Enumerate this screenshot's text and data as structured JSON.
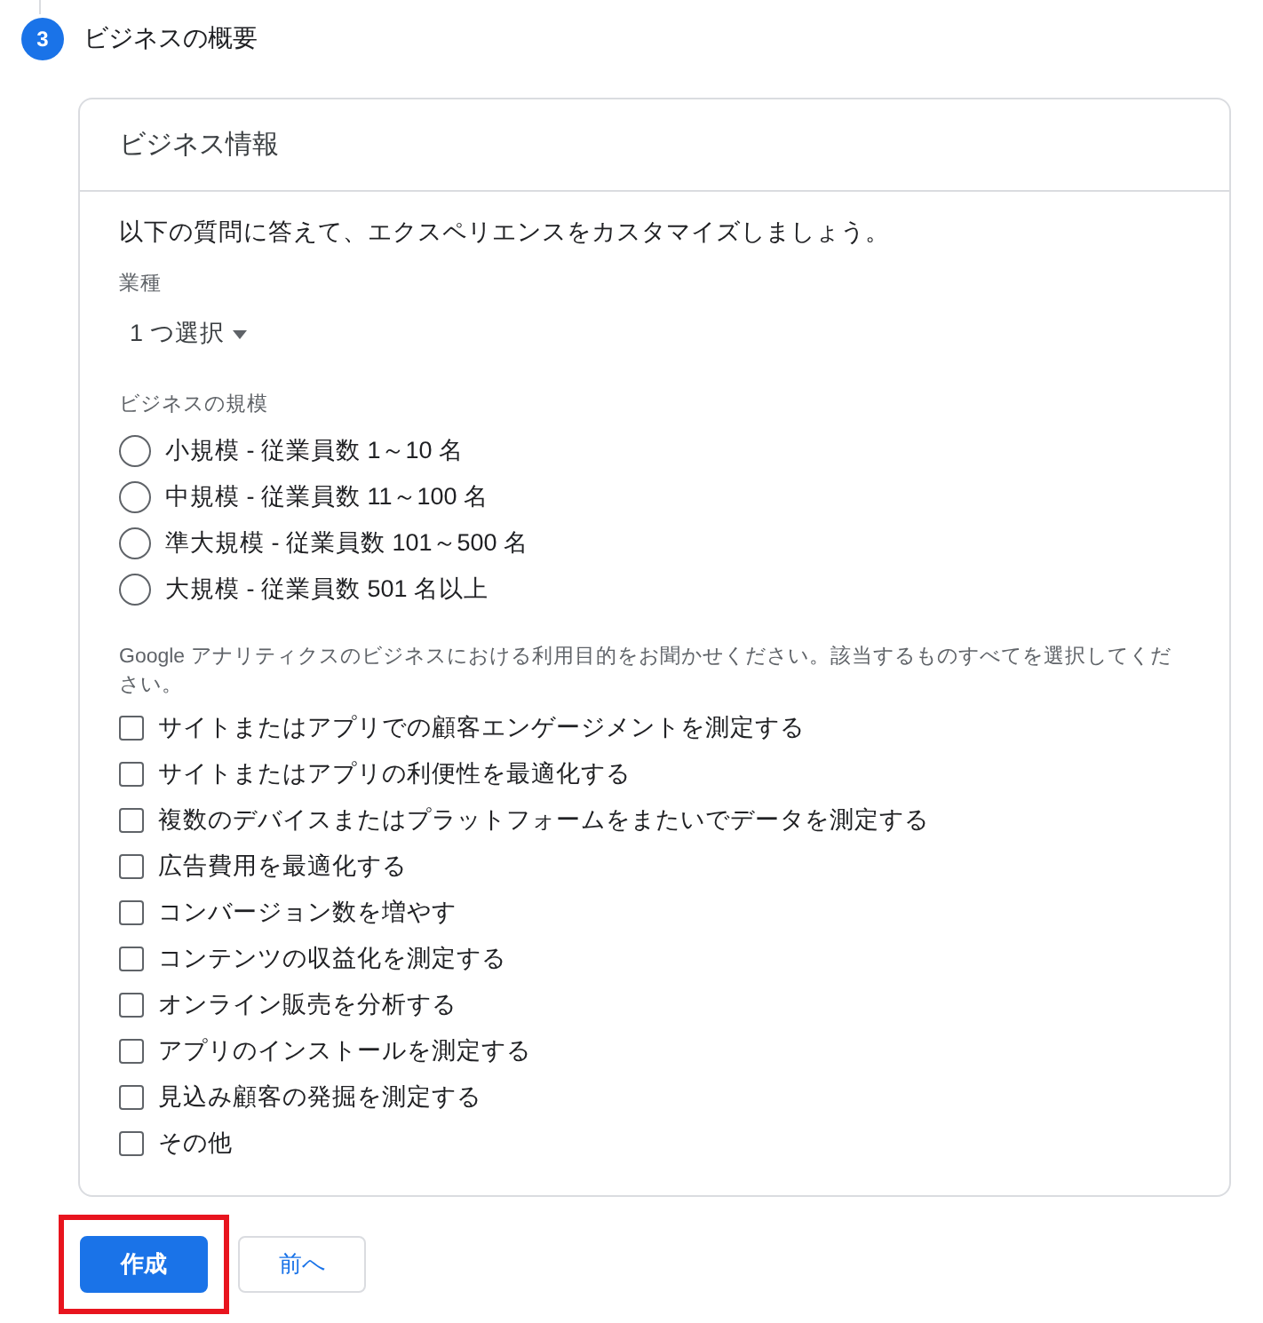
{
  "step": {
    "number": "3",
    "title": "ビジネスの概要",
    "active": true
  },
  "card": {
    "title": "ビジネス情報",
    "intro": "以下の質問に答えて、エクスペリエンスをカスタマイズしましょう。",
    "industry": {
      "label": "業種",
      "value": "1 つ選択"
    },
    "size": {
      "label": "ビジネスの規模",
      "options": [
        {
          "label": "小規模 - 従業員数 1～10 名",
          "selected": false
        },
        {
          "label": "中規模 - 従業員数 11～100 名",
          "selected": false
        },
        {
          "label": "準大規模 - 従業員数 101～500 名",
          "selected": false
        },
        {
          "label": "大規模 - 従業員数 501 名以上",
          "selected": false
        }
      ]
    },
    "purpose": {
      "label": "Google アナリティクスのビジネスにおける利用目的をお聞かせください。該当するものすべてを選択してください。",
      "options": [
        {
          "label": "サイトまたはアプリでの顧客エンゲージメントを測定する",
          "checked": false
        },
        {
          "label": "サイトまたはアプリの利便性を最適化する",
          "checked": false
        },
        {
          "label": "複数のデバイスまたはプラットフォームをまたいでデータを測定する",
          "checked": false
        },
        {
          "label": "広告費用を最適化する",
          "checked": false
        },
        {
          "label": "コンバージョン数を増やす",
          "checked": false
        },
        {
          "label": "コンテンツの収益化を測定する",
          "checked": false
        },
        {
          "label": "オンライン販売を分析する",
          "checked": false
        },
        {
          "label": "アプリのインストールを測定する",
          "checked": false
        },
        {
          "label": "見込み顧客の発掘を測定する",
          "checked": false
        },
        {
          "label": "その他",
          "checked": false
        }
      ]
    }
  },
  "buttons": [
    {
      "label": "作成",
      "kind": "primary",
      "highlighted": true
    },
    {
      "label": "前へ",
      "kind": "secondary",
      "highlighted": false
    }
  ]
}
